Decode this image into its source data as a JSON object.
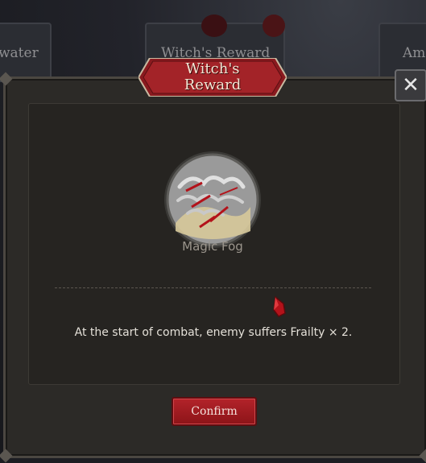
{
  "background": {
    "cards": [
      {
        "label": "water"
      },
      {
        "label": "Witch's Reward"
      },
      {
        "label": "Am"
      }
    ]
  },
  "dialog": {
    "title": "Witch's\nReward",
    "close_icon": "close-icon",
    "relic": {
      "icon": "magic-fog-icon",
      "name": "Magic Fog"
    },
    "gem_icon": "red-gem-icon",
    "description": "At the start of combat, enemy suffers Frailty × 2.",
    "confirm_label": "Confirm"
  },
  "colors": {
    "accent_red": "#a61e24",
    "panel": "#2c2a27",
    "text_light": "#e4e0d8"
  }
}
